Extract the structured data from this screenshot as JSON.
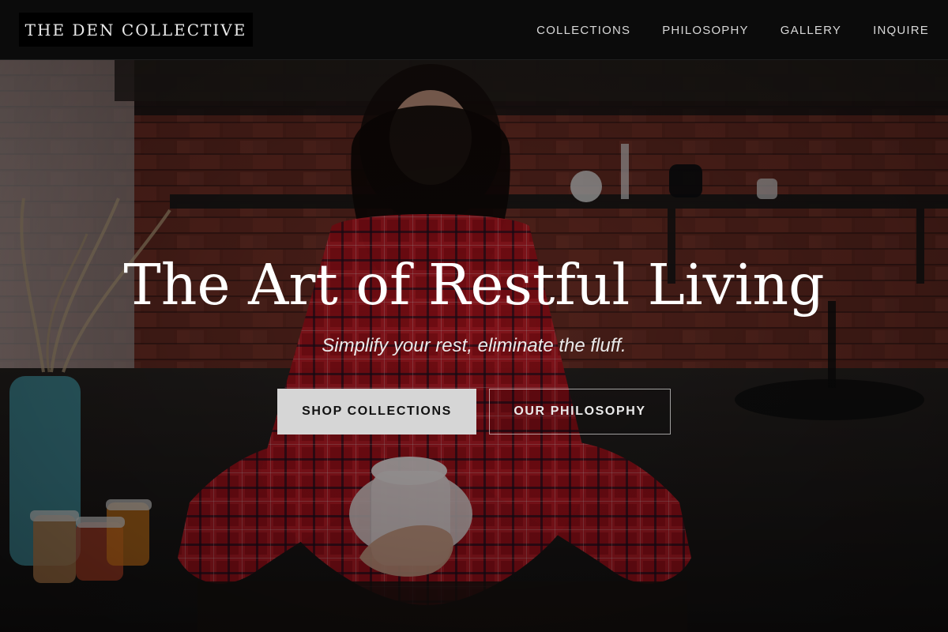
{
  "header": {
    "brand": "THE DEN COLLECTIVE",
    "nav": [
      {
        "label": "COLLECTIONS"
      },
      {
        "label": "PHILOSOPHY"
      },
      {
        "label": "GALLERY"
      },
      {
        "label": "INQUIRE"
      }
    ]
  },
  "hero": {
    "title": "The Art of Restful Living",
    "subtitle": "Simplify your rest, eliminate the fluff.",
    "primary_button": "SHOP COLLECTIONS",
    "secondary_button": "OUR PHILOSOPHY"
  },
  "colors": {
    "header_bg": "#0b0b0b",
    "brand_bg": "#000000",
    "primary_button_bg": "#d6d6d6",
    "text_light": "#ffffff"
  },
  "icons": {
    "hero_image": "woman-in-plaid-pajamas-holding-mug-kitchen-photo"
  }
}
